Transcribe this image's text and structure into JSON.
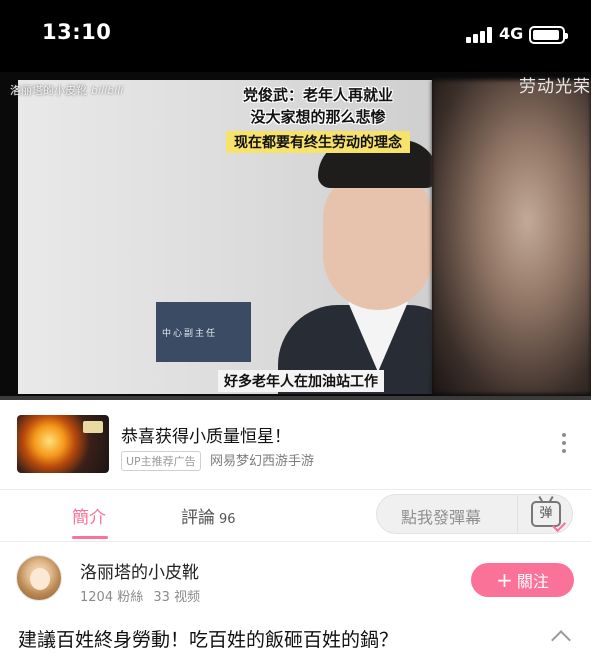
{
  "status_bar": {
    "time": "13:10",
    "network": "4G",
    "signal_icon": "cellular-signal-icon",
    "battery_icon": "battery-icon"
  },
  "video": {
    "watermark_user": "洛丽塔的小皮靴",
    "watermark_logo": "bilibili",
    "overlay_text_right": "劳动光荣",
    "caption_line1": "党俊武：老年人再就业",
    "caption_line2": "没大家想的那么悲惨",
    "caption_highlight": "现在都要有终生劳动的理念",
    "caption_bottom": "好多老年人在加油站工作",
    "background_sign": "中心副主任",
    "progress_fraction": 0.0,
    "accent_color": "#fb7299"
  },
  "ad": {
    "title": "恭喜获得小质量恒星！",
    "badge": "UP主推荐广告",
    "source": "网易梦幻西游手游",
    "more_icon": "more-vertical-icon"
  },
  "tabs": {
    "intro_label": "簡介",
    "comments_label": "評論",
    "comments_count": "96",
    "danmaku_placeholder": "點我發彈幕",
    "danmaku_icon_label": "弹"
  },
  "uploader": {
    "name": "洛丽塔的小皮靴",
    "fans": "1204",
    "fans_label": "粉絲",
    "videos": "33",
    "videos_label": "视频",
    "follow_label": "關注",
    "follow_icon": "plus-icon"
  },
  "video_title": "建議百姓終身勞動！吃百姓的飯砸百姓的鍋？"
}
